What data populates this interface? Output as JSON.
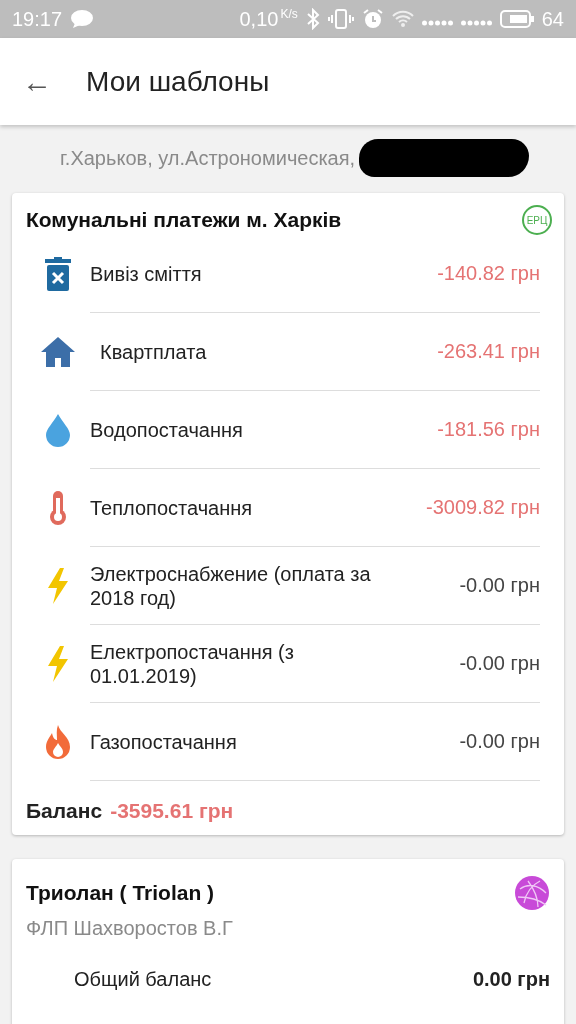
{
  "status_bar": {
    "time": "19:17",
    "speed": "0,10",
    "speed_unit": "K/s",
    "battery": "64"
  },
  "app_bar": {
    "back": "←",
    "title": "Мои шаблоны"
  },
  "address": "г.Харьков, ул.Астрономическая,",
  "utility_card": {
    "title": "Комунальні платежи м. Харків",
    "badge": "ЕРЦ",
    "items": [
      {
        "kind": "trash",
        "name": "Вивіз сміття",
        "amount": "-140.82 грн",
        "debt": true
      },
      {
        "kind": "house",
        "name": "Квартплата",
        "amount": "-263.41 грн",
        "debt": true
      },
      {
        "kind": "drop",
        "name": "Водопостачання",
        "amount": "-181.56 грн",
        "debt": true
      },
      {
        "kind": "thermometer",
        "name": "Теплопостачання",
        "amount": "-3009.82 грн",
        "debt": true
      },
      {
        "kind": "bolt",
        "name": "Электроснабжение (оплата за 2018 год)",
        "amount": "-0.00 грн",
        "debt": false
      },
      {
        "kind": "bolt",
        "name": "Електропостачання (з 01.01.2019)",
        "amount": "-0.00 грн",
        "debt": false
      },
      {
        "kind": "flame",
        "name": "Газопостачання",
        "amount": "-0.00 грн",
        "debt": false
      }
    ],
    "balance_label": "Баланс",
    "balance": "-3595.61 грн"
  },
  "provider_card": {
    "title": "Триолан ( Triolan )",
    "subtitle": "ФЛП Шахворостов В.Г",
    "rows": [
      {
        "label": "Общий баланс",
        "value": "0.00 грн"
      }
    ]
  }
}
